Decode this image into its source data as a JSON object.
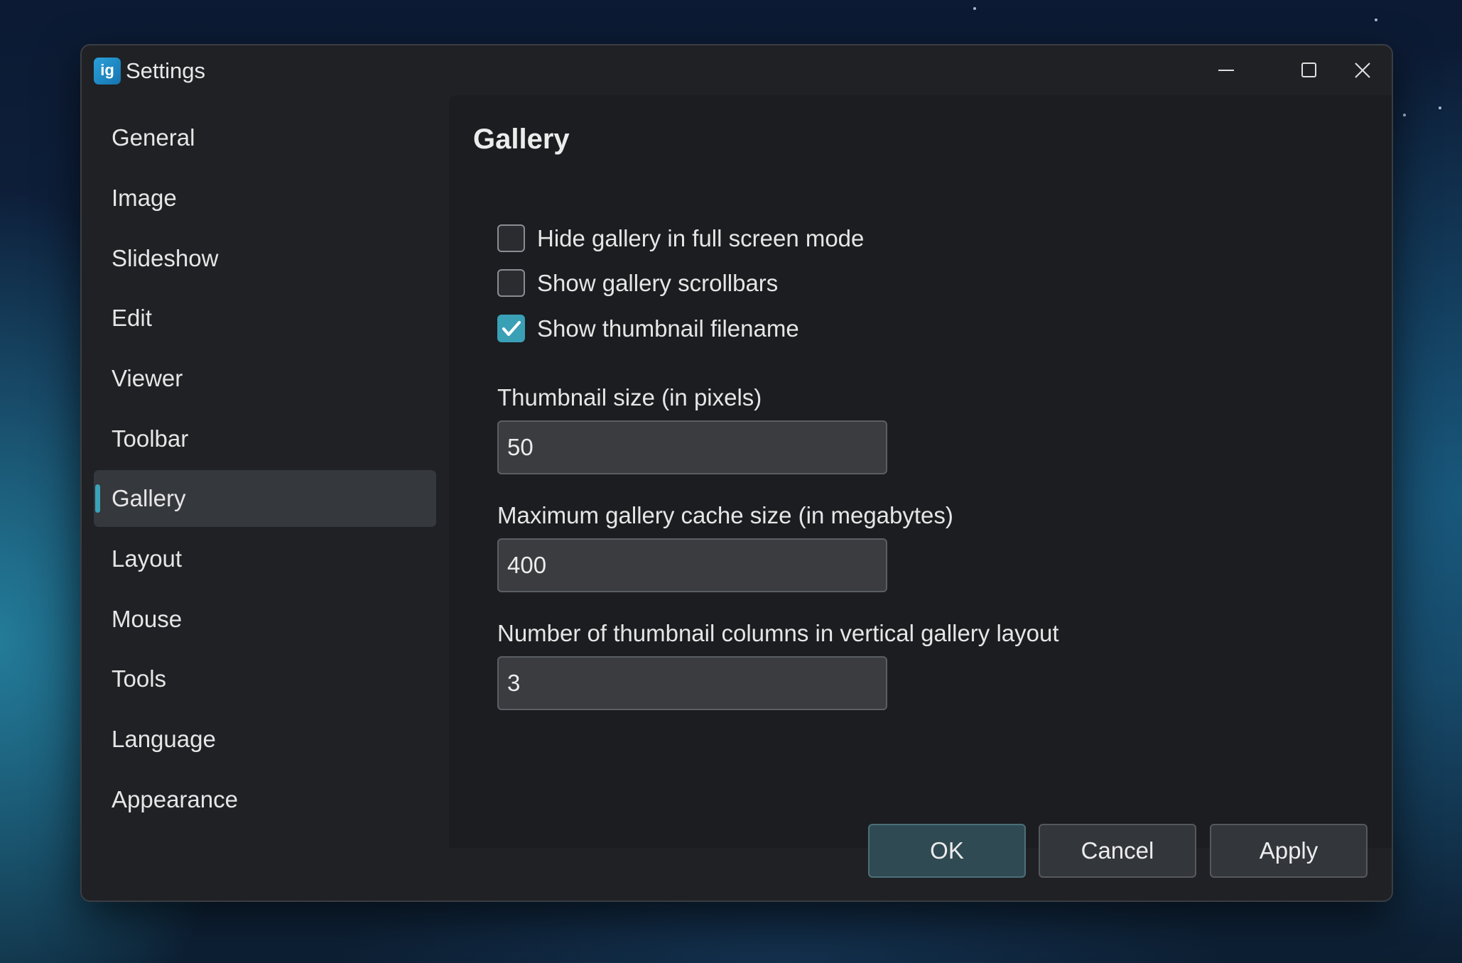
{
  "window": {
    "title": "Settings",
    "app_icon_text": "ig",
    "controls": [
      "minimize-icon",
      "maximize-icon",
      "close-icon"
    ]
  },
  "sidebar": {
    "items": [
      {
        "label": "General"
      },
      {
        "label": "Image"
      },
      {
        "label": "Slideshow"
      },
      {
        "label": "Edit"
      },
      {
        "label": "Viewer"
      },
      {
        "label": "Toolbar"
      },
      {
        "label": "Gallery",
        "selected": true
      },
      {
        "label": "Layout"
      },
      {
        "label": "Mouse"
      },
      {
        "label": "Tools"
      },
      {
        "label": "Language"
      },
      {
        "label": "Appearance"
      }
    ]
  },
  "gallery": {
    "heading": "Gallery",
    "checkboxes": [
      {
        "label": "Hide gallery in full screen mode",
        "checked": false
      },
      {
        "label": "Show gallery scrollbars",
        "checked": false
      },
      {
        "label": "Show thumbnail filename",
        "checked": true
      }
    ],
    "thumbnail_size": {
      "label": "Thumbnail size (in pixels)",
      "value": "50"
    },
    "cache_size": {
      "label": "Maximum gallery cache size (in megabytes)",
      "value": "400"
    },
    "columns": {
      "label": "Number of thumbnail columns in vertical gallery layout",
      "value": "3"
    }
  },
  "footer": {
    "ok_label": "OK",
    "cancel_label": "Cancel",
    "apply_label": "Apply"
  },
  "colors": {
    "accent": "#3aa0b6",
    "window_bg": "#1f2125",
    "content_bg": "#1b1d20"
  }
}
